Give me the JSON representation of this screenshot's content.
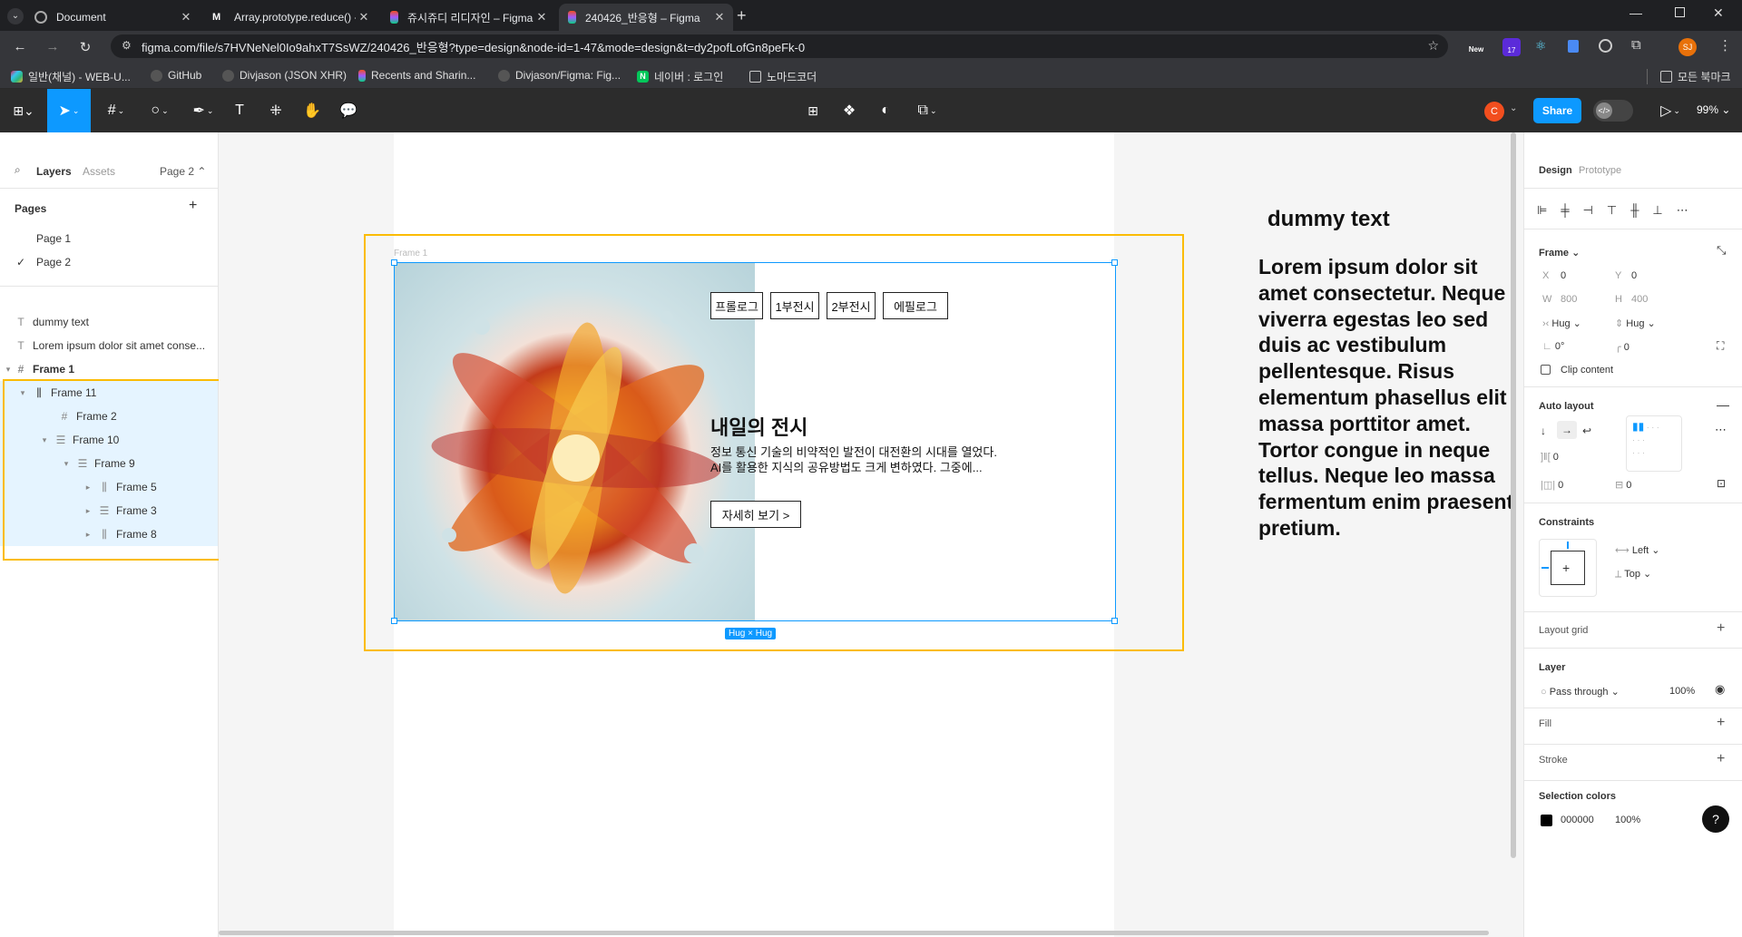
{
  "browser": {
    "tabs": [
      {
        "title": "Document"
      },
      {
        "title": "Array.prototype.reduce() - Java"
      },
      {
        "title": "쥬시쥬디 리디자인 – Figma"
      },
      {
        "title": "240426_반응형 – Figma"
      }
    ],
    "url": "figma.com/file/s7HVNeNel0Io9ahxT7SsWZ/240426_반응형?type=design&node-id=1-47&mode=design&t=dy2pofLofGn8peFk-0",
    "bookmarks": [
      "일반(채널) - WEB-U...",
      "GitHub",
      "Divjason (JSON XHR)",
      "Recents and Sharin...",
      "Divjason/Figma: Fig...",
      "네이버 : 로그인",
      "노마드코더"
    ],
    "all_bookmarks": "모든 북마크",
    "new_badge": "New",
    "count_badge": "17",
    "profile": "SJ"
  },
  "toolbar": {
    "share_label": "Share",
    "zoom": "99%",
    "avatar": "C"
  },
  "left_panel": {
    "tabs": {
      "layers": "Layers",
      "assets": "Assets",
      "page": "Page 2"
    },
    "pages_heading": "Pages",
    "pages": [
      "Page 1",
      "Page 2"
    ],
    "layers": [
      "dummy text",
      "Lorem ipsum dolor sit amet conse...",
      "Frame 1",
      "Frame 11",
      "Frame 2",
      "Frame 10",
      "Frame 9",
      "Frame 5",
      "Frame 3",
      "Frame 8"
    ]
  },
  "canvas": {
    "frame_label": "Frame 1",
    "nav": [
      "프롤로그",
      "1부전시",
      "2부전시",
      "에필로그"
    ],
    "heading": "내일의 전시",
    "desc_line1": "정보 통신 기술의 비약적인 발전이 대전환의 시대를 열었다.",
    "desc_line2": "AI를 활용한 지식의 공유방법도 크게 변하였다. 그중에...",
    "more_button": "자세히 보기 >",
    "size_badge": "Hug × Hug",
    "dummy_title": "dummy text",
    "lorem": "Lorem ipsum dolor sit amet consectetur. Neque viverra egestas leo sed duis ac vestibulum pellentesque. Risus elementum phasellus elit massa porttitor amet. Tortor congue in neque tellus. Neque leo massa fermentum enim praesent pretium."
  },
  "right_panel": {
    "tabs": {
      "design": "Design",
      "prototype": "Prototype"
    },
    "frame_label": "Frame",
    "x_label": "X",
    "x": "0",
    "y_label": "Y",
    "y": "0",
    "w_label": "W",
    "w": "800",
    "h_label": "H",
    "h": "400",
    "hug_w": "Hug",
    "hug_h": "Hug",
    "rotation": "0°",
    "radius": "0",
    "clip": "Clip content",
    "auto_layout": "Auto layout",
    "gap": "0",
    "pad_h": "0",
    "pad_v": "0",
    "constraints": "Constraints",
    "c_left": "Left",
    "c_top": "Top",
    "layout_grid": "Layout grid",
    "layer": "Layer",
    "pass_through": "Pass through",
    "opacity": "100%",
    "fill": "Fill",
    "stroke": "Stroke",
    "selection_colors": "Selection colors",
    "sel_hex": "000000",
    "sel_opacity": "100%",
    "help": "?"
  },
  "colors": {
    "accent": "#0d99ff",
    "highlight": "#fbbc05"
  }
}
